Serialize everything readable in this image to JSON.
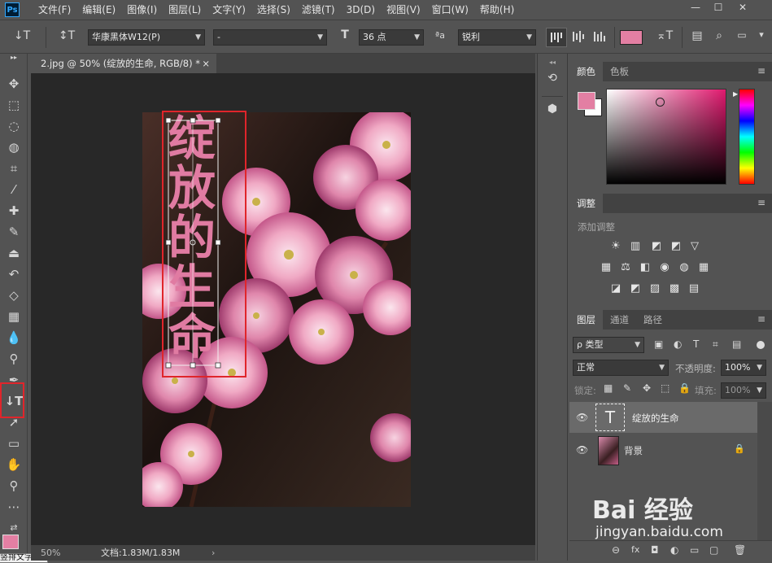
{
  "app": {
    "logo": "Ps"
  },
  "menu": [
    "文件(F)",
    "编辑(E)",
    "图像(I)",
    "图层(L)",
    "文字(Y)",
    "选择(S)",
    "滤镜(T)",
    "3D(D)",
    "视图(V)",
    "窗口(W)",
    "帮助(H)"
  ],
  "window_controls": [
    "—",
    "☐",
    "✕"
  ],
  "options": {
    "font_family": "华康黑体W12(P)",
    "font_style": "-",
    "font_size": "36 点",
    "aa_label": "ªa",
    "antialias": "锐利",
    "text_color": "#e37fa3"
  },
  "document": {
    "tab_title": "2.jpg @ 50% (绽放的生命, RGB/8) *",
    "tab_close": "×",
    "text_chars": [
      "绽",
      "放",
      "的",
      "生",
      "命"
    ],
    "text_color": "#e07ba2"
  },
  "status": {
    "zoom": "50%",
    "doc_info": "文档:1.83M/1.83M",
    "arrow": "›",
    "tooltip": "竖排文字"
  },
  "color_panel": {
    "tabs": [
      "颜色",
      "色板"
    ],
    "foreground": "#e37fa3",
    "background": "#ffffff",
    "hue_color": "#e0196e"
  },
  "adjust_panel": {
    "tabs": [
      "调整"
    ],
    "label": "添加调整",
    "rows": [
      [
        "☀",
        "▥",
        "◩",
        "▽"
      ],
      [
        "▦",
        "⚖",
        "◧",
        "◉",
        "◍",
        "▦"
      ],
      [
        "◪",
        "◩",
        "▨",
        "▩",
        "▤"
      ]
    ]
  },
  "layers_panel": {
    "tabs": [
      "图层",
      "通道",
      "路径"
    ],
    "filter": "ρ 类型",
    "blend": "正常",
    "opacity_label": "不透明度:",
    "opacity": "100%",
    "lock_label": "锁定:",
    "fill_label": "填充:",
    "fill": "100%",
    "layers": [
      {
        "name": "绽放的生命",
        "type": "text",
        "selected": true
      },
      {
        "name": "背景",
        "type": "image",
        "locked": true
      }
    ],
    "bottom_icons": [
      "⊖",
      "fx",
      "◘",
      "◐",
      "▭",
      "▢",
      "🗑"
    ]
  },
  "watermark": {
    "text": "Bai 经验",
    "url": "jingyan.baidu.com"
  },
  "accent": "#e0252b"
}
